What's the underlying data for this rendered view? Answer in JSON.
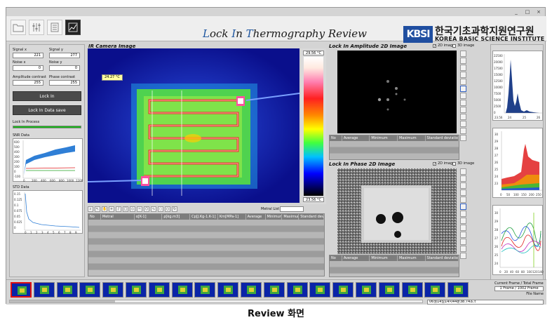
{
  "window_controls": [
    "_",
    "□",
    "×"
  ],
  "title": {
    "prefix_l": "L",
    "part1": "ock ",
    "prefix_i": "I",
    "part2": "n ",
    "prefix_t": "T",
    "part3": "hermography Review"
  },
  "brand": {
    "logo": "KBSI",
    "name_ko": "한국기초과학지원연구원",
    "name_en": "KOREA BASIC SCIENCE INSTITUTE"
  },
  "toolbar": {
    "icons": [
      "folder-icon",
      "sliders-icon",
      "document-icon",
      "chart-icon"
    ]
  },
  "left_panel": {
    "signal_x_label": "Signal x",
    "signal_x_value": "221",
    "signal_y_label": "Signal y",
    "signal_y_value": "277",
    "noise_x_label": "Noise x",
    "noise_x_value": "0",
    "noise_y_label": "Noise y",
    "noise_y_value": "0",
    "amp_contrast_label": "Amplitude contrast",
    "amp_contrast_value": "255",
    "phase_contrast_label": "Phase contrast",
    "phase_contrast_value": "255",
    "lock_in_button": "Lock In",
    "lock_in_save_button": "Lock In Data save",
    "lock_in_process_label": "Lock In Process",
    "lock_in_progress": 1.0,
    "snr_label": "SNR Data",
    "snr_y_ticks": [
      "600",
      "500",
      "400",
      "300",
      "200",
      "100",
      "0",
      "-100"
    ],
    "snr_x_ticks": [
      "0",
      "200",
      "400",
      "600",
      "800",
      "1000",
      "1200"
    ],
    "std_label": "STD Data",
    "std_y_ticks": [
      "0.15",
      "0.125",
      "0.1",
      "0.075",
      "0.05",
      "0.025",
      "0"
    ],
    "std_x_ticks": [
      "0",
      "1",
      "2",
      "3",
      "4",
      "5",
      "6",
      "7",
      "8",
      "9"
    ]
  },
  "ir_panel": {
    "title": "IR Camera Image",
    "temp_label": "24.27 °C",
    "colorbar_max": "29.56 °C",
    "colorbar_min": "23.56 °C",
    "metal_list_label": "Metral List",
    "table_headers": [
      "No",
      "Metral",
      "α[K-1]",
      "ρ[kg.m3]",
      "Cp[J.Kg-1.K-1]",
      "Km[MPa-1]",
      "Average",
      "Minimum",
      "Maximum",
      "Standard deviation"
    ]
  },
  "amplitude_panel": {
    "title": "Lock In Amplitude 2D Image",
    "opt_2d": "2D image",
    "opt_3d": "3D image",
    "table_headers": [
      "No",
      "Average",
      "Minimum",
      "Maximum",
      "Standard deviation"
    ]
  },
  "phase_panel": {
    "title": "Lock In Phase 2D Image",
    "opt_2d": "2D image",
    "opt_3d": "3D image",
    "table_headers": [
      "No",
      "Average",
      "Minimum",
      "Maximum",
      "Standard deviation"
    ]
  },
  "right_graphs": {
    "hist_y_ticks": [
      "22500",
      "20000",
      "17500",
      "15000",
      "12500",
      "10000",
      "7500",
      "5000",
      "2500",
      "0"
    ],
    "hist_x_ticks": [
      "23.56",
      "24",
      "25",
      "26"
    ],
    "g2_y_ticks": [
      "30",
      "29",
      "28",
      "27",
      "26",
      "25",
      "24",
      "23"
    ],
    "g2_x_ticks": [
      "0",
      "50",
      "100",
      "150",
      "200",
      "250"
    ],
    "g3_y_ticks": [
      "30",
      "29",
      "28",
      "27",
      "26",
      "25",
      "24"
    ],
    "g3_x_ticks": [
      "0",
      "20",
      "40",
      "60",
      "80",
      "100",
      "120",
      "140"
    ]
  },
  "frames": {
    "count_visible": 20,
    "selected_index": 0,
    "current_label": "Current Frame / Total Frame",
    "current_value": "1 Frame / 1002 Frame",
    "file_name_label": "File Name",
    "file_name_value": "06월14일14시44분38.74초.t"
  },
  "caption": "Review 화면",
  "colors": {
    "ir_background": "#0a0f8c",
    "accent_blue": "#1e56a0",
    "progress_green": "#19b419",
    "selected_frame": "#e01010"
  }
}
